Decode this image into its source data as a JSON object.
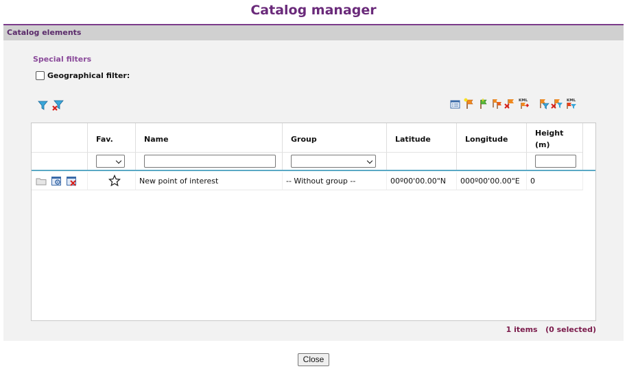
{
  "title": "Catalog manager",
  "panel": {
    "header": "Catalog elements",
    "special_filters": "Special filters",
    "geo_filter_label": "Geographical filter:",
    "geo_filter_checked": false
  },
  "toolbar_left": [
    "filter-icon",
    "clear-filter-icon"
  ],
  "toolbar_right": [
    "select-list-icon",
    "new-flag-icon",
    "flag-green-icon",
    "flag-copy-icon",
    "flag-delete-icon",
    "export-kml-icon",
    "flag-filter-icon",
    "flag-filter-delete-icon",
    "kml-filter-icon"
  ],
  "table": {
    "columns": {
      "fav": "Fav.",
      "name": "Name",
      "group": "Group",
      "latitude": "Latitude",
      "longitude": "Longitude",
      "height_line1": "Height",
      "height_line2": "(m)"
    },
    "filters": {
      "fav_selected": "",
      "name_value": "",
      "group_selected": "",
      "height_value": ""
    },
    "rows": [
      {
        "favorite": false,
        "name": "New point of interest",
        "group": "-- Without group --",
        "latitude": "00º00'00.00\"N",
        "longitude": "000º00'00.00\"E",
        "height": "0"
      }
    ]
  },
  "status": {
    "items": "1 items",
    "selected": "(0 selected)"
  },
  "close_label": "Close"
}
